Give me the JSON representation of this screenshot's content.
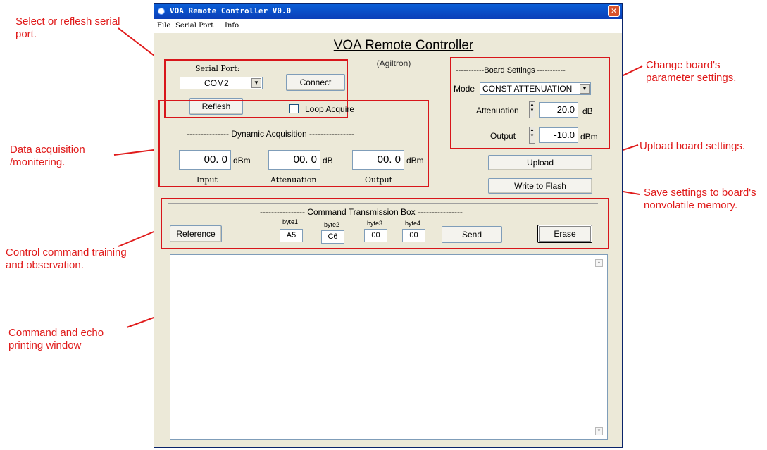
{
  "window": {
    "title": "VOA Remote Controller V0.0",
    "close_glyph": "✕",
    "menu": [
      "File",
      "Serial Port",
      "Info"
    ]
  },
  "header": {
    "title": "VOA Remote Controller",
    "subtitle": "(Agiltron)"
  },
  "serial": {
    "label": "Serial Port:",
    "selected": "COM2",
    "connect_label": "Connect",
    "refresh_label": "Reflesh"
  },
  "loop_acquire": {
    "label": "Loop Acquire",
    "checked": false
  },
  "dynamic": {
    "title": "--------------- Dynamic Acquisition ----------------",
    "input": {
      "value": "00. 0",
      "unit": "dBm",
      "label": "Input"
    },
    "attenuation": {
      "value": "00. 0",
      "unit": "dB",
      "label": "Attenuation"
    },
    "output": {
      "value": "00. 0",
      "unit": "dBm",
      "label": "Output"
    }
  },
  "board": {
    "title": "-----------Board Settings -----------",
    "mode_label": "Mode",
    "mode_value": "CONST ATTENUATION",
    "attenuation_label": "Attenuation",
    "attenuation_value": "20.0",
    "attenuation_unit": "dB",
    "output_label": "Output",
    "output_value": "-10.0",
    "output_unit": "dBm",
    "upload_label": "Upload",
    "flash_label": "Write to Flash"
  },
  "command": {
    "title": "---------------- Command Transmission Box ----------------",
    "reference_label": "Reference",
    "bytes": [
      {
        "label": "byte1",
        "value": "A5"
      },
      {
        "label": "byte2",
        "value": "C6"
      },
      {
        "label": "byte3",
        "value": "00"
      },
      {
        "label": "byte4",
        "value": "00"
      }
    ],
    "send_label": "Send",
    "erase_label": "Erase"
  },
  "scroll": {
    "up": "▲",
    "down": "▼"
  },
  "annotations": {
    "serial": "Select or reflesh serial port.",
    "acquisition": "Data acquisition /monitering.",
    "control": "Control command training and observation.",
    "echo": "Command and echo printing window",
    "board": "Change board's parameter settings.",
    "upload": "Upload board settings.",
    "flash": "Save settings to board's nonvolatile memory."
  },
  "colors": {
    "annotation": "#e01b1b",
    "titlebar": "#0a4fc8",
    "window_bg": "#ece9d8"
  }
}
